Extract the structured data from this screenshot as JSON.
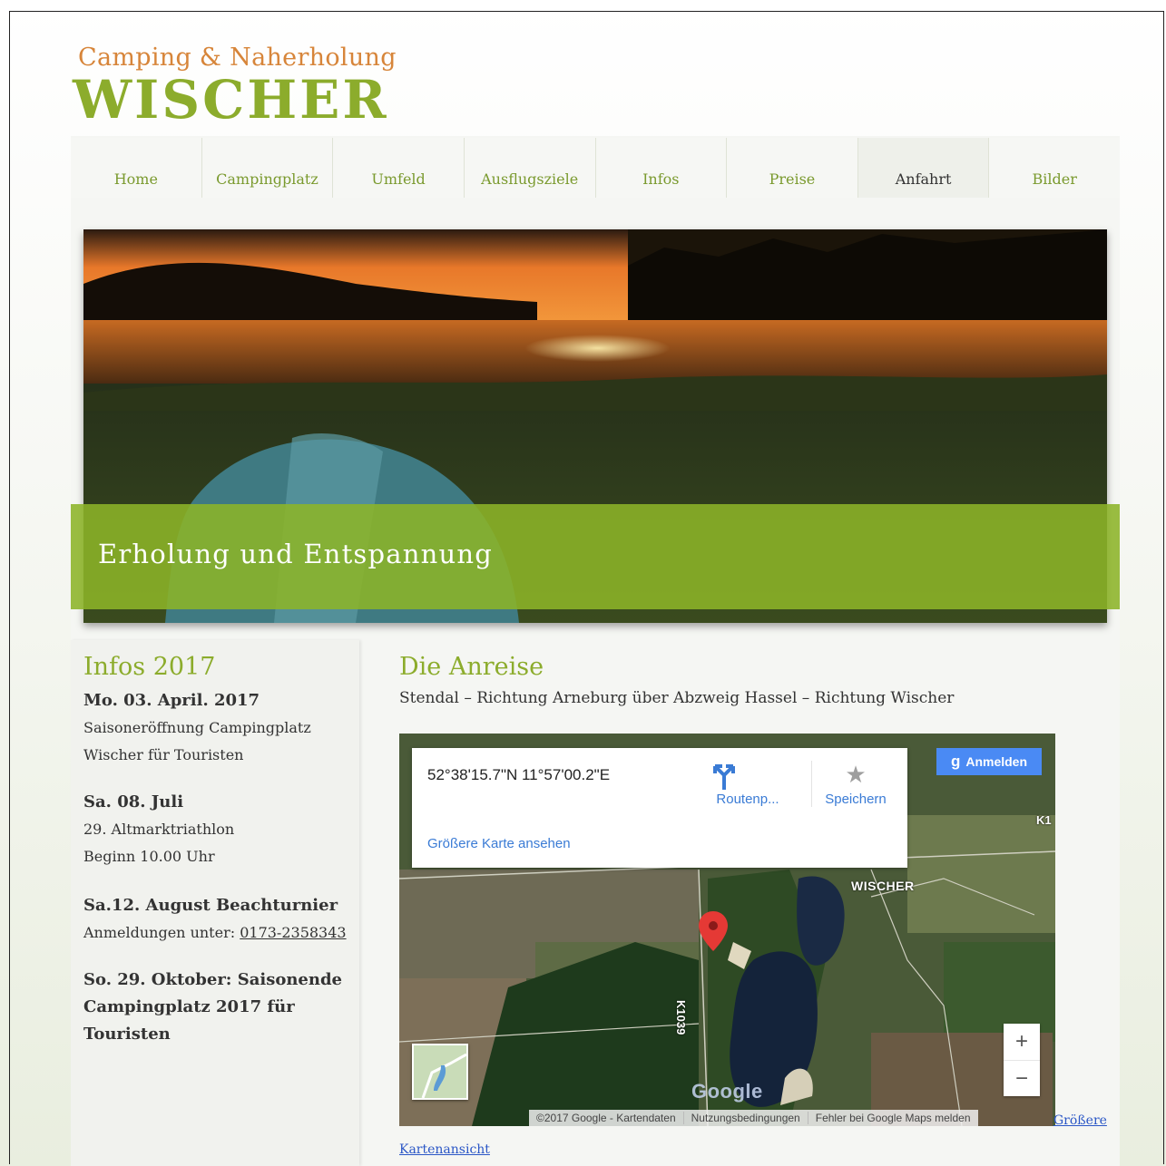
{
  "logo": {
    "top": "Camping & Naherholung",
    "main": "WISCHER"
  },
  "nav": [
    {
      "label": "Home"
    },
    {
      "label": "Campingplatz"
    },
    {
      "label": "Umfeld"
    },
    {
      "label": "Ausflugsziele"
    },
    {
      "label": "Infos"
    },
    {
      "label": "Preise"
    },
    {
      "label": "Anfahrt",
      "active": true
    },
    {
      "label": "Bilder"
    }
  ],
  "hero": {
    "banner": "Erholung und Entspannung"
  },
  "sidebar": {
    "title": "Infos 2017",
    "events": [
      {
        "heading": "Mo. 03. April. 2017",
        "lines": [
          "Saisoneröffnung Campingplatz",
          "Wischer für Touristen"
        ]
      },
      {
        "heading": "Sa. 08. Juli",
        "lines": [
          "29. Altmarktriathlon",
          "Beginn 10.00 Uhr"
        ]
      },
      {
        "heading": "Sa.12. August Beachturnier",
        "line_prefix": "Anmeldungen unter: ",
        "phone": "0173-2358343"
      },
      {
        "heading_lines": [
          "So. 29. Oktober: Saisonende",
          "Campingplatz 2017 für",
          "Touristen"
        ]
      }
    ]
  },
  "main": {
    "title": "Die Anreise",
    "route": "Stendal – Richtung Arneburg über Abzweig Hassel – Richtung Wischer"
  },
  "map": {
    "coords": "52°38'15.7\"N 11°57'00.2\"E",
    "bigger_map": "Größere Karte ansehen",
    "route_label": "Routenp...",
    "save_label": "Speichern",
    "signin": "Anmelden",
    "place_label": "WISCHER",
    "road_label": "K1039",
    "k_label": "K1",
    "zoom_in": "+",
    "zoom_out": "−",
    "google": "Google",
    "attribution": [
      "©2017 Google - Kartendaten",
      "Nutzungsbedingungen",
      "Fehler bei Google Maps melden"
    ]
  },
  "larger_view_link": {
    "line1": "Größere",
    "line2": "Kartenansicht"
  },
  "colors": {
    "accent": "#8cac2c",
    "logo_top": "#d7853a",
    "link": "#3a7bd5"
  }
}
